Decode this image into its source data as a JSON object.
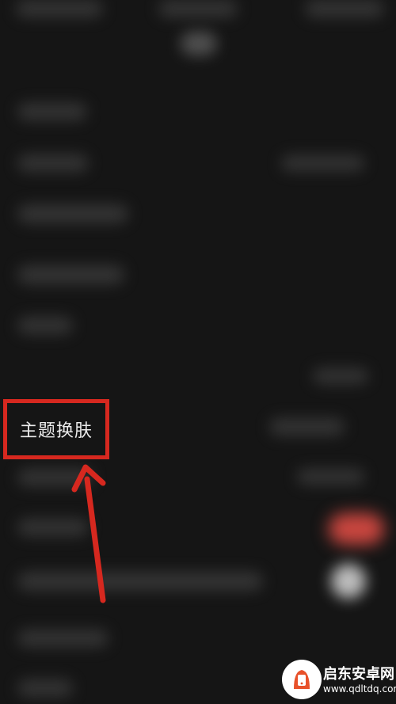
{
  "highlight": {
    "label": "主题换肤",
    "color": "#d6281f"
  },
  "watermark": {
    "title": "启东安卓网",
    "url": "www.qdltdq.com",
    "icon": "phone-logo-icon"
  },
  "colors": {
    "background": "#151515",
    "toggle_on": "#c9463f",
    "toggle_off": "#cfcfcf"
  }
}
